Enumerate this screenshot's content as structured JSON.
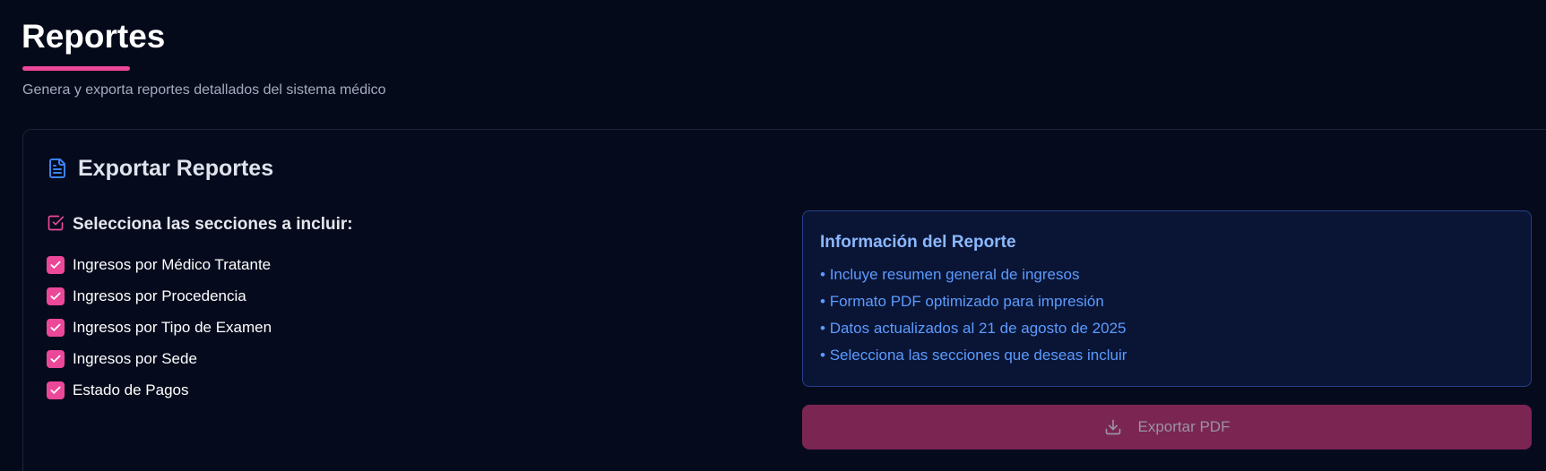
{
  "page": {
    "title": "Reportes",
    "subtitle": "Genera y exporta reportes detallados del sistema médico"
  },
  "card": {
    "title": "Exportar Reportes",
    "title_icon": "file-text-icon"
  },
  "sections": {
    "title": "Selecciona las secciones a incluir:",
    "title_icon": "square-check-icon",
    "items": [
      {
        "label": "Ingresos por Médico Tratante",
        "checked": true
      },
      {
        "label": "Ingresos por Procedencia",
        "checked": true
      },
      {
        "label": "Ingresos por Tipo de Examen",
        "checked": true
      },
      {
        "label": "Ingresos por Sede",
        "checked": true
      },
      {
        "label": "Estado de Pagos",
        "checked": true
      }
    ]
  },
  "info": {
    "title": "Información del Reporte",
    "items": [
      "Incluye resumen general de ingresos",
      "Formato PDF optimizado para impresión",
      "Datos actualizados al 21 de agosto de 2025",
      "Selecciona las secciones que deseas incluir"
    ]
  },
  "export": {
    "label": "Exportar PDF",
    "icon": "download-icon"
  },
  "colors": {
    "background": "#050a1a",
    "accent": "#ec4899",
    "info_text": "#5c9bff",
    "info_title": "#8cb8ff",
    "export_button": "#7a2552"
  }
}
